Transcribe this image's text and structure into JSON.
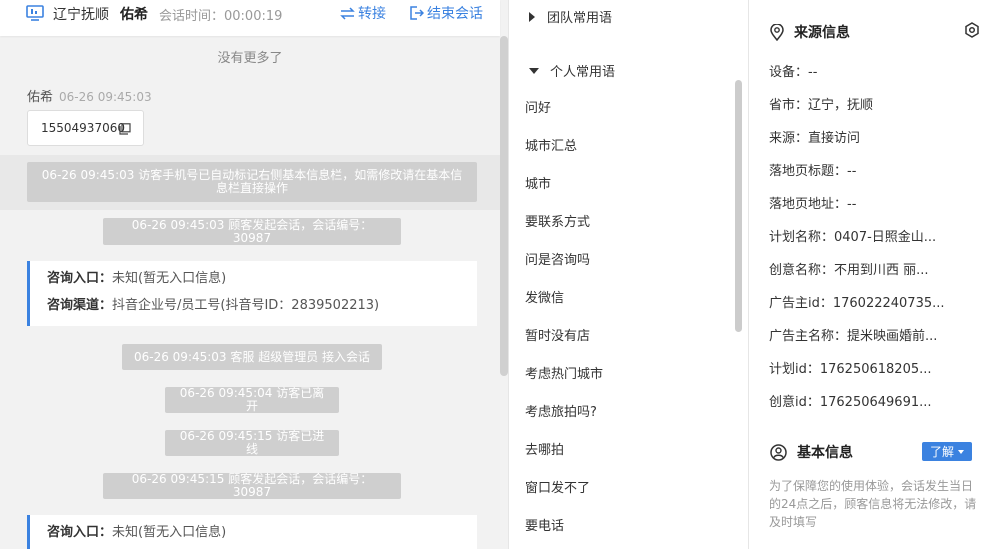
{
  "header": {
    "source": "辽宁抚顺",
    "visitor_name": "佑希",
    "session_time": "会话时间：00:00:19",
    "transfer_label": "转接",
    "end_label": "结束会话"
  },
  "chat": {
    "no_more": "没有更多了",
    "sender_name": "佑希",
    "sender_time": "06-26 09:45:03",
    "phone": "15504937060",
    "sys_1": "06-26 09:45:03 访客手机号已自动标记右侧基本信息栏，如需修改请在基本信息栏直接操作",
    "sys_2": "06-26 09:45:03 顾客发起会话，会话编号：30987",
    "card_1": {
      "entry_key": "咨询入口：",
      "entry_val": "未知(暂无入口信息)",
      "channel_key": "咨询渠道：",
      "channel_val": "抖音企业号/员工号(抖音号ID：2839502213)"
    },
    "sys_3": "06-26 09:45:03 客服 超级管理员 接入会话",
    "sys_4": "06-26 09:45:04 访客已离开",
    "sys_5": "06-26 09:45:15 访客已进线",
    "sys_6": "06-26 09:45:15 顾客发起会话，会话编号：30987",
    "card_2": {
      "entry_key": "咨询入口：",
      "entry_val": "未知(暂无入口信息)"
    }
  },
  "phrases": {
    "team_group": "团队常用语",
    "personal_group": "个人常用语",
    "items": [
      "问好",
      "城市汇总",
      "城市",
      "要联系方式",
      "问是咨询吗",
      "发微信",
      "暂时没有店",
      "考虑热门城市",
      "考虑旅拍吗?",
      "去哪拍",
      "窗口发不了",
      "要电话"
    ]
  },
  "info": {
    "source_title": "来源信息",
    "fields": [
      "设备：--",
      "省市：辽宁，抚顺",
      "来源：直接访问",
      "落地页标题：--",
      "落地页地址：--",
      "计划名称：0407-日照金山...",
      "创意名称：不用到川西 丽...",
      "广告主id：176022240735...",
      "广告主名称：提米映画婚前...",
      "计划id：176250618205...",
      "创意id：176250649691..."
    ],
    "basic_title": "基本信息",
    "learn_label": "了解",
    "notice": "为了保障您的使用体验，会话发生当日的24点之后，顾客信息将无法修改，请及时填写"
  },
  "colors": {
    "accent": "#3b82e0",
    "system_bubble": "#cfcfcf"
  }
}
